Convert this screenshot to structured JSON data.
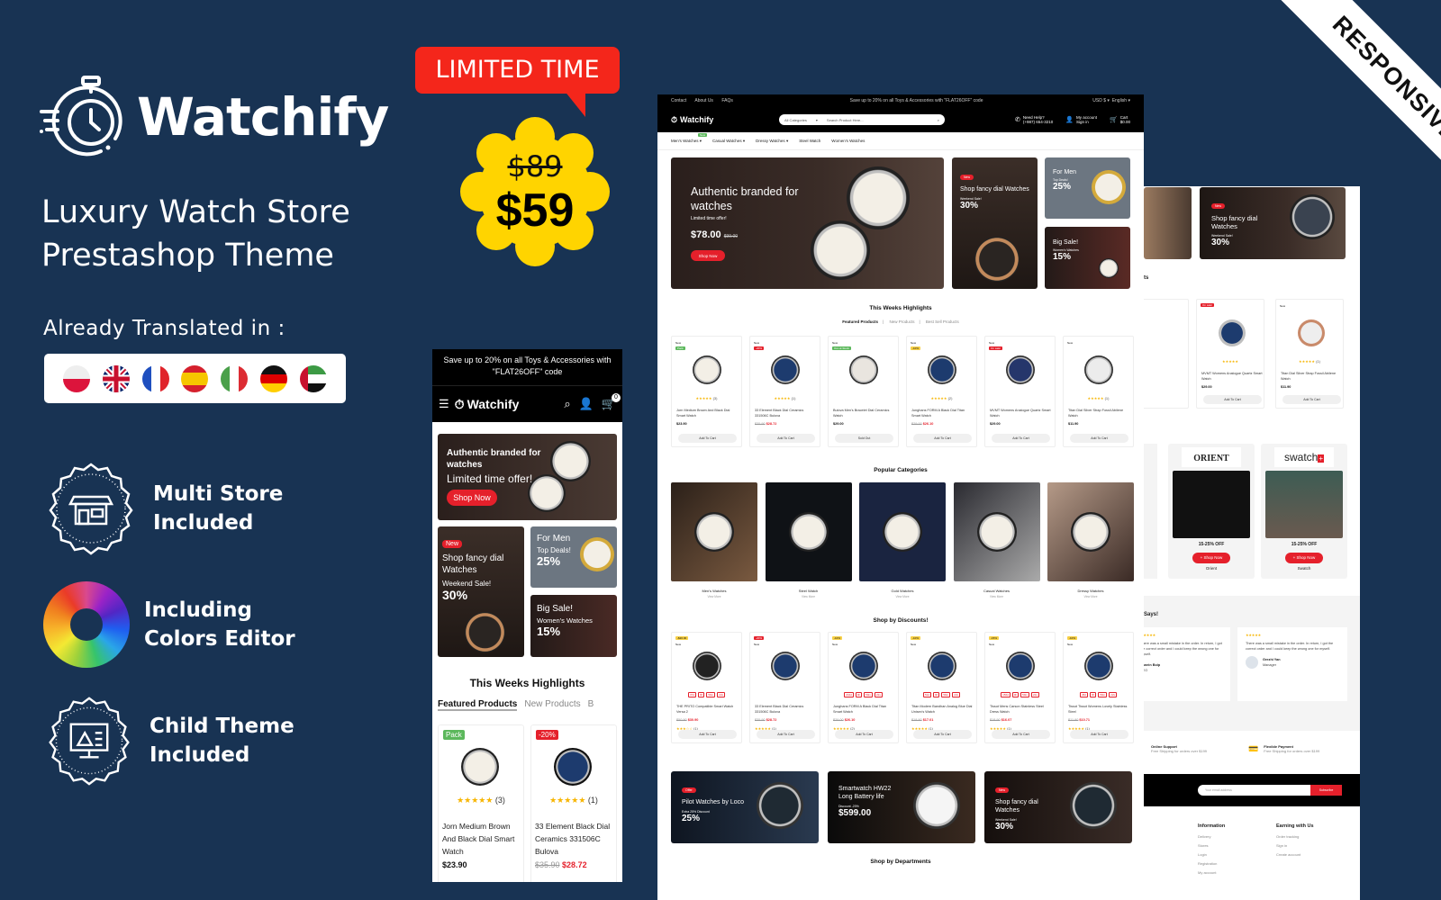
{
  "brand": {
    "name": "Watchify",
    "tagline_line1": "Luxury Watch Store",
    "tagline_line2": "Prestashop Theme",
    "translated_label": "Already Translated in :",
    "flags": [
      "poland-flag",
      "uk-flag",
      "france-flag",
      "spain-flag",
      "italy-flag",
      "germany-flag",
      "uae-flag"
    ]
  },
  "features": [
    {
      "line1": "Multi Store",
      "line2": "Included",
      "icon": "store-badge-icon"
    },
    {
      "line1": "Including",
      "line2": "Colors Editor",
      "icon": "color-wheel-icon"
    },
    {
      "line1": "Child Theme",
      "line2": "Included",
      "icon": "child-theme-badge-icon"
    }
  ],
  "promo": {
    "limited_label": "LIMITED TIME",
    "old_price": "$89",
    "new_price": "$59"
  },
  "ribbon": "RESPONSIVE",
  "desktop": {
    "topbar": {
      "links": [
        "Contact",
        "About Us",
        "FAQs"
      ],
      "message": "Save up to 20% on all Toys & Accessories with \"FLAT26OFF\" code",
      "currency": "USD $",
      "language": "English"
    },
    "header": {
      "logo": "Watchify",
      "category_select": "All Categories",
      "search_placeholder": "Search Product Here...",
      "help_label": "Need Help?",
      "phone": "(+987) 654-3210",
      "account_label": "My account",
      "signin_label": "Sign in",
      "cart_label": "Cart",
      "cart_total": "$0.00",
      "cart_count": "0"
    },
    "nav": [
      {
        "label": "Men's Watches",
        "badge": "New"
      },
      {
        "label": "Casual Watches"
      },
      {
        "label": "Dressy Watches"
      },
      {
        "label": "Steel Watch"
      },
      {
        "label": "Women's Watches"
      }
    ],
    "hero": {
      "title": "Authentic branded for watches",
      "subtitle": "Limited time offer!",
      "price": "$78.00",
      "old_price": "$99.00",
      "button": "Shop Now"
    },
    "side_promos": [
      {
        "tag": "New",
        "title": "Shop fancy dial Watches",
        "small": "Weekend Sale!",
        "value": "30%"
      },
      {
        "title": "For Men",
        "small": "Top Deals!",
        "value": "25%"
      },
      {
        "title": "Big Sale!",
        "small": "Women's Watches",
        "value": "15%"
      }
    ],
    "highlights": {
      "title": "This Weeks Highlights",
      "tabs": [
        "Featured Products",
        "New Products",
        "Best Sell Products"
      ],
      "products": [
        {
          "badge": "New",
          "badge2": "Pack",
          "badge2_color": "#5cb85c",
          "rating": 5,
          "reviews": "(3)",
          "name": "Jorn Medium Brown And Black Dial Smart Watch",
          "price": "$23.90",
          "old_price": "",
          "button": "Add To Cart"
        },
        {
          "badge": "New",
          "badge2": "-20%",
          "badge2_color": "#e5202b",
          "rating": 5,
          "reviews": "(1)",
          "name": "33 Element Black Dial Ceramics 331506C Bulova",
          "price": "$28.72",
          "old_price": "$35.90",
          "button": "Add To Cart"
        },
        {
          "badge": "New",
          "badge2": "Out-of-Stock",
          "badge2_color": "#5cb85c",
          "rating": 0,
          "reviews": "",
          "name": "Bulova Men's Bracelet Dial Ceramics Watch",
          "price": "$29.00",
          "old_price": "",
          "button": "Sold Out"
        },
        {
          "badge": "New",
          "badge2": "-10%",
          "badge2_color": "#f7d046",
          "rating": 5,
          "reviews": "(2)",
          "name": "Junghans FORM A Black Dial Titan Smart Watch",
          "price": "$26.10",
          "old_price": "$29.00",
          "button": "Add To Cart"
        },
        {
          "badge": "New",
          "badge2": "On sale!",
          "badge2_color": "#e5202b",
          "rating": 0,
          "reviews": "",
          "name": "MVMT Womens Analogue Quartz Smart Watch",
          "price": "$29.00",
          "old_price": "",
          "button": "Add To Cart"
        },
        {
          "badge": "New",
          "badge2": "",
          "badge2_color": "",
          "rating": 5,
          "reviews": "(1)",
          "name": "Titan Dial Silver Strap Fossil Abilene Watch",
          "price": "$11.90",
          "old_price": "",
          "button": "Add To Cart"
        }
      ]
    },
    "categories": {
      "title": "Popular Categories",
      "items": [
        {
          "label": "Men's Watches",
          "view": "View More"
        },
        {
          "label": "Steel Watch",
          "view": "View More"
        },
        {
          "label": "Gold Watches",
          "view": "View More"
        },
        {
          "label": "Casual Watches",
          "view": "View More"
        },
        {
          "label": "Dressy Watches",
          "view": "View More"
        }
      ]
    },
    "discounts": {
      "title": "Shop by Discounts!",
      "products": [
        {
          "badge": "-$20.00",
          "badge_color": "#f7d046",
          "timer": [
            "37d",
            "9h",
            "59m",
            "22s"
          ],
          "name": "THE PRITO Compatible Smart Watch Versa 2",
          "old_price": "$50.90",
          "price": "$30.90",
          "rating": 3,
          "reviews": "(1)",
          "button": "Add To Cart"
        },
        {
          "badge": "-20%",
          "badge_color": "#e5202b",
          "timer": [],
          "name": "33 Element Black Dial Ceramics 331506C Bulova",
          "old_price": "$35.90",
          "price": "$28.72",
          "rating": 5,
          "reviews": "(1)",
          "button": "Add To Cart"
        },
        {
          "badge": "-10%",
          "badge_color": "#f7d046",
          "timer": [
            "204d",
            "9h",
            "59m",
            "22s"
          ],
          "name": "Junghans FORM A Black Dial Titan Smart Watch",
          "old_price": "$29.00",
          "price": "$26.10",
          "rating": 5,
          "reviews": "(2)",
          "button": "Add To Cart"
        },
        {
          "badge": "-10%",
          "badge_color": "#f7d046",
          "timer": [
            "51d",
            "9h",
            "59m",
            "22s"
          ],
          "name": "Titan Modern Bandhan Analog Blue Dial Unisex's Watch",
          "old_price": "$18.90",
          "price": "$17.01",
          "rating": 5,
          "reviews": "(1)",
          "button": "Add To Cart"
        },
        {
          "badge": "-15%",
          "badge_color": "#f7d046",
          "timer": [
            "156d",
            "9h",
            "59m",
            "22s"
          ],
          "name": "Tissot Mens Carson Stainless Steel Dress Watch",
          "old_price": "$18.90",
          "price": "$16.07",
          "rating": 5,
          "reviews": "(1)",
          "button": "Add To Cart"
        },
        {
          "badge": "-10%",
          "badge_color": "#f7d046",
          "timer": [
            "45d",
            "9h",
            "59m",
            "22s"
          ],
          "name": "Tissot Tissot Womens Lovely Stainless Steel",
          "old_price": "$11.90",
          "price": "$10.71",
          "rating": 5,
          "reviews": "(1)",
          "button": "Add To Cart"
        }
      ]
    },
    "bottom_banners": [
      {
        "tag": "Offer",
        "title": "Pilot Watches by Loco",
        "small": "Extra 25% Discount",
        "value": "25%"
      },
      {
        "tag": "",
        "title": "Smartwatch HW22 Long Battery life",
        "small": "Discount -20%",
        "value": "$599.00"
      },
      {
        "tag": "New",
        "title": "Shop fancy dial Watches",
        "small": "Weekend Sale!",
        "value": "30%"
      }
    ],
    "departments_title": "Shop by Departments"
  },
  "mobile": {
    "announcement": "Save up to 20% on all Toys & Accessories with \"FLAT26OFF\" code",
    "logo": "Watchify",
    "cart_count": "0",
    "hero": {
      "title": "Authentic branded for watches",
      "subtitle": "Limited time offer!",
      "button": "Shop Now"
    },
    "promos": [
      {
        "tag": "New",
        "title": "Shop fancy dial Watches",
        "small": "Weekend Sale!",
        "value": "30%"
      },
      {
        "title": "For Men",
        "small": "Top Deals!",
        "value": "25%"
      },
      {
        "title": "Big Sale!",
        "small": "Women's Watches",
        "value": "15%"
      }
    ],
    "section_title": "This Weeks Highlights",
    "tabs": [
      "Featured Products",
      "New Products",
      "B"
    ],
    "products": [
      {
        "badge": "Pack",
        "badge_color": "#5cb85c",
        "reviews": "(3)",
        "name": "Jorn Medium Brown And Black Dial Smart Watch",
        "price": "$23.90",
        "old_price": ""
      },
      {
        "badge": "-20%",
        "badge_color": "#e5202b",
        "reviews": "(1)",
        "name": "33 Element Black Dial Ceramics 331506C Bulova",
        "price": "$28.72",
        "old_price": "$35.90"
      }
    ]
  },
  "tablet": {
    "promo": {
      "tag": "New",
      "title": "Shop fancy dial Watches",
      "small": "Weekend Sale!",
      "value": "30%"
    },
    "products": [
      {
        "name": "MVMT Womens Analogue Quartz Smart Watch",
        "price": "$29.00",
        "badge": "On sale!",
        "button": "Add To Cart"
      },
      {
        "name": "Titan Dial Silver Strap Fossil Abilene Watch",
        "price": "$11.90",
        "badge": "New",
        "button": "Add To Cart"
      }
    ],
    "brands": [
      {
        "logo": "ORIENT",
        "offer": "15-25% OFF",
        "button": "+ Shop Now",
        "name": "Orient"
      },
      {
        "logo": "swatch",
        "offer": "15-25% OFF",
        "button": "+ Shop Now",
        "name": "Swatch"
      }
    ],
    "testimonials_title": "Says!",
    "testimonials": [
      {
        "text": "There was a small mistake in the order. In return, I got the correct order and I could keep the wrong one for myself.",
        "name": "Hanein Boip",
        "role": "CEO"
      },
      {
        "text": "There was a small mistake in the order. In return, I got the correct order and I could keep the wrong one for myself.",
        "name": "Grezhi Yan",
        "role": "Manager"
      }
    ],
    "services": [
      {
        "title": "Online Support",
        "desc": "Free Shipping for orders over $199"
      },
      {
        "title": "Flexible Payment",
        "desc": "Free Shipping for orders over $199"
      }
    ],
    "newsletter": {
      "placeholder": "Your email address",
      "button": "Subscribe"
    },
    "footer": [
      {
        "title": "Information",
        "links": [
          "Delivery",
          "Stores",
          "Login",
          "Registration",
          "My account"
        ]
      },
      {
        "title": "Earning with Us",
        "links": [
          "Order tracking",
          "Sign in",
          "Create account"
        ]
      }
    ]
  }
}
